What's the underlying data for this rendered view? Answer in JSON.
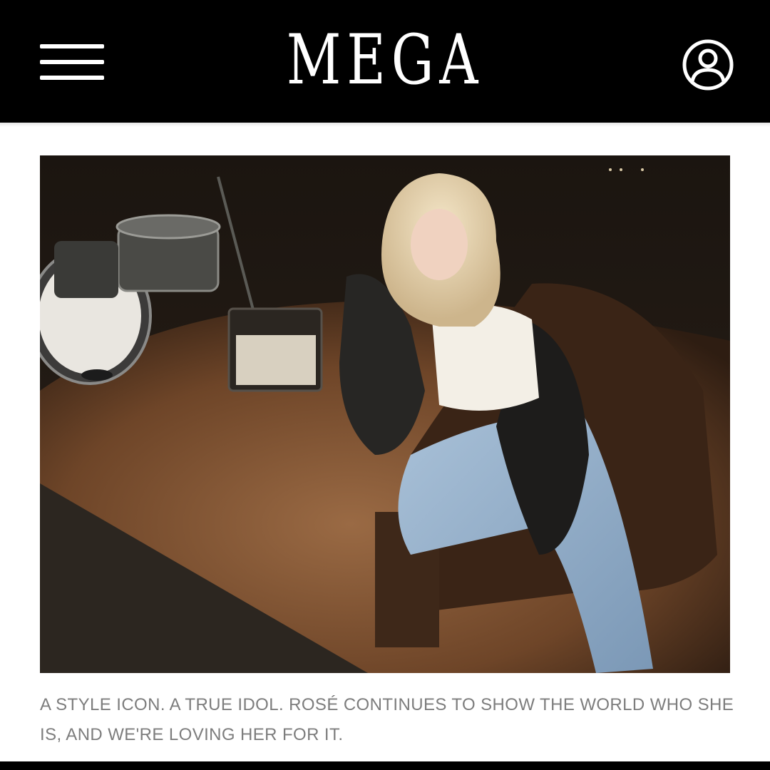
{
  "header": {
    "brand": "MEGA",
    "menu_icon": "hamburger-menu-icon",
    "account_icon": "user-account-icon"
  },
  "article": {
    "caption": "A STYLE ICON. A TRUE IDOL. ROSÉ CONTINUES TO SHOW THE WORLD WHO SHE IS, AND WE'RE LOVING HER FOR IT."
  },
  "colors": {
    "header_bg": "#000000",
    "caption_text": "#7d7d7d",
    "page_bg": "#ffffff"
  }
}
